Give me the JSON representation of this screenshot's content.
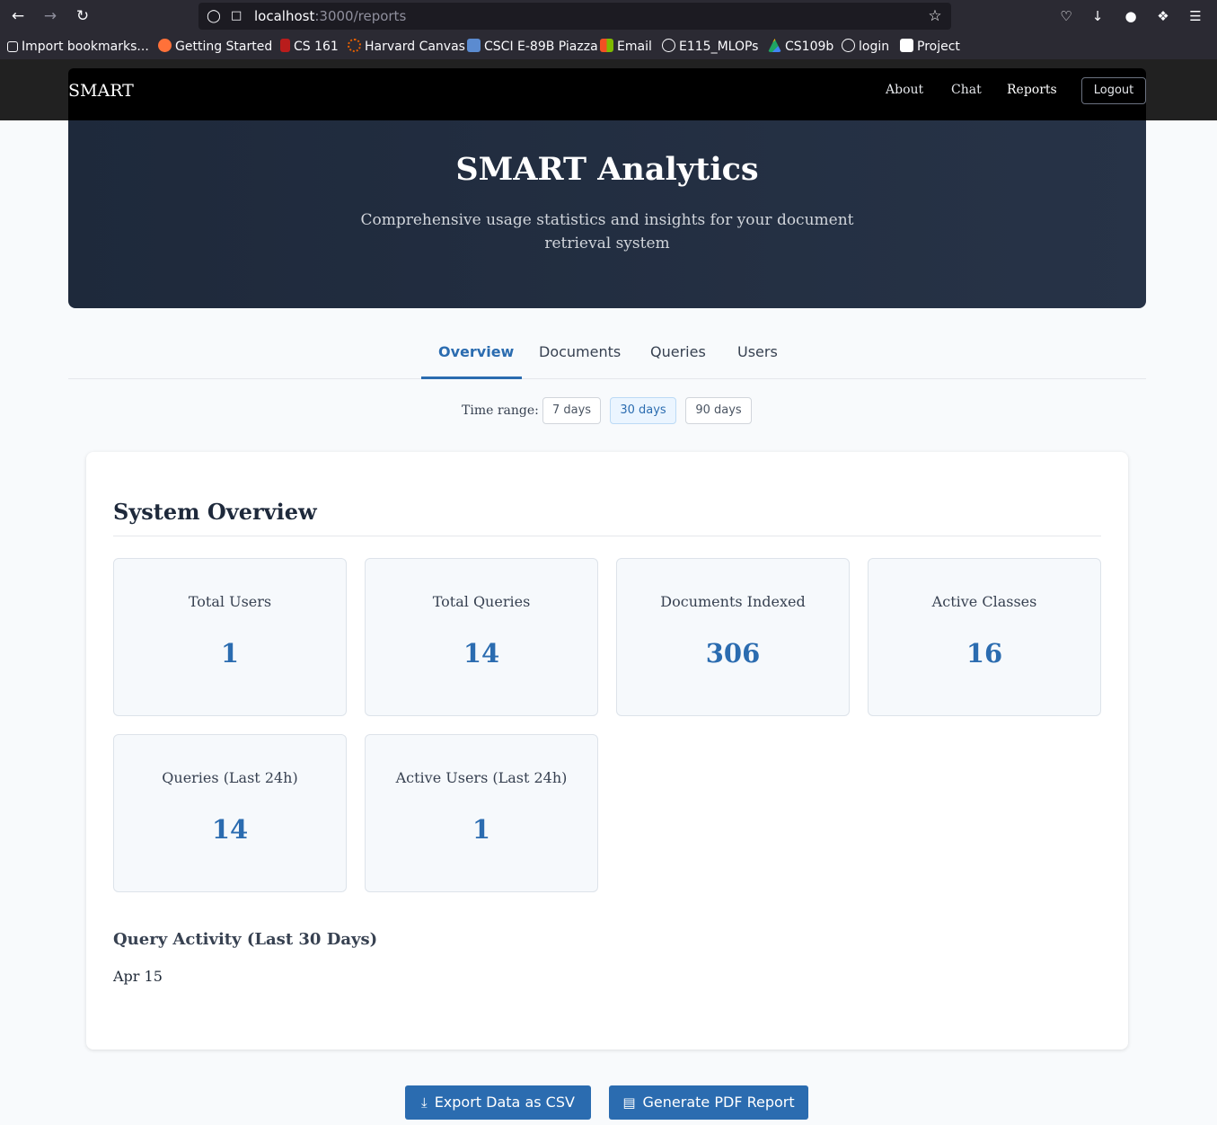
{
  "browser": {
    "url_host": "localhost",
    "url_path": ":3000/reports",
    "bookmarks": [
      {
        "label": "Import bookmarks...",
        "color": "#fbfbfe"
      },
      {
        "label": "Getting Started",
        "color": "#ff7139"
      },
      {
        "label": "CS 161",
        "color": "#b91c1c"
      },
      {
        "label": "Harvard Canvas",
        "color": "#e66000"
      },
      {
        "label": "CSCI E-89B Piazza",
        "color": "#5b8bd0"
      },
      {
        "label": "Email",
        "color": "#f25022"
      },
      {
        "label": "E115_MLOPs",
        "color": "#fbfbfe"
      },
      {
        "label": "CS109b",
        "color": "#1fa463"
      },
      {
        "label": "login",
        "color": "#fbfbfe"
      },
      {
        "label": "Project",
        "color": "#ffffff"
      }
    ]
  },
  "nav": {
    "brand": "SMART",
    "links": [
      "About",
      "Chat",
      "Reports"
    ],
    "logout": "Logout"
  },
  "hero": {
    "title": "SMART Analytics",
    "subtitle": "Comprehensive usage statistics and insights for your document retrieval system"
  },
  "tabs": [
    "Overview",
    "Documents",
    "Queries",
    "Users"
  ],
  "time_range": {
    "label": "Time range:",
    "options": [
      "7 days",
      "30 days",
      "90 days"
    ],
    "selected": "30 days"
  },
  "overview": {
    "title": "System Overview",
    "stats": [
      {
        "label": "Total Users",
        "value": "1"
      },
      {
        "label": "Total Queries",
        "value": "14"
      },
      {
        "label": "Documents Indexed",
        "value": "306"
      },
      {
        "label": "Active Classes",
        "value": "16"
      },
      {
        "label": "Queries (Last 24h)",
        "value": "14"
      },
      {
        "label": "Active Users (Last 24h)",
        "value": "1"
      }
    ],
    "activity_title": "Query Activity (Last 30 Days)",
    "activity_date": "Apr 15"
  },
  "actions": {
    "export_csv": "Export Data as CSV",
    "generate_pdf": "Generate PDF Report"
  },
  "colors": {
    "accent": "#2b6cb0",
    "hero_bg": "#1e293b",
    "nav_bg": "#000000"
  }
}
